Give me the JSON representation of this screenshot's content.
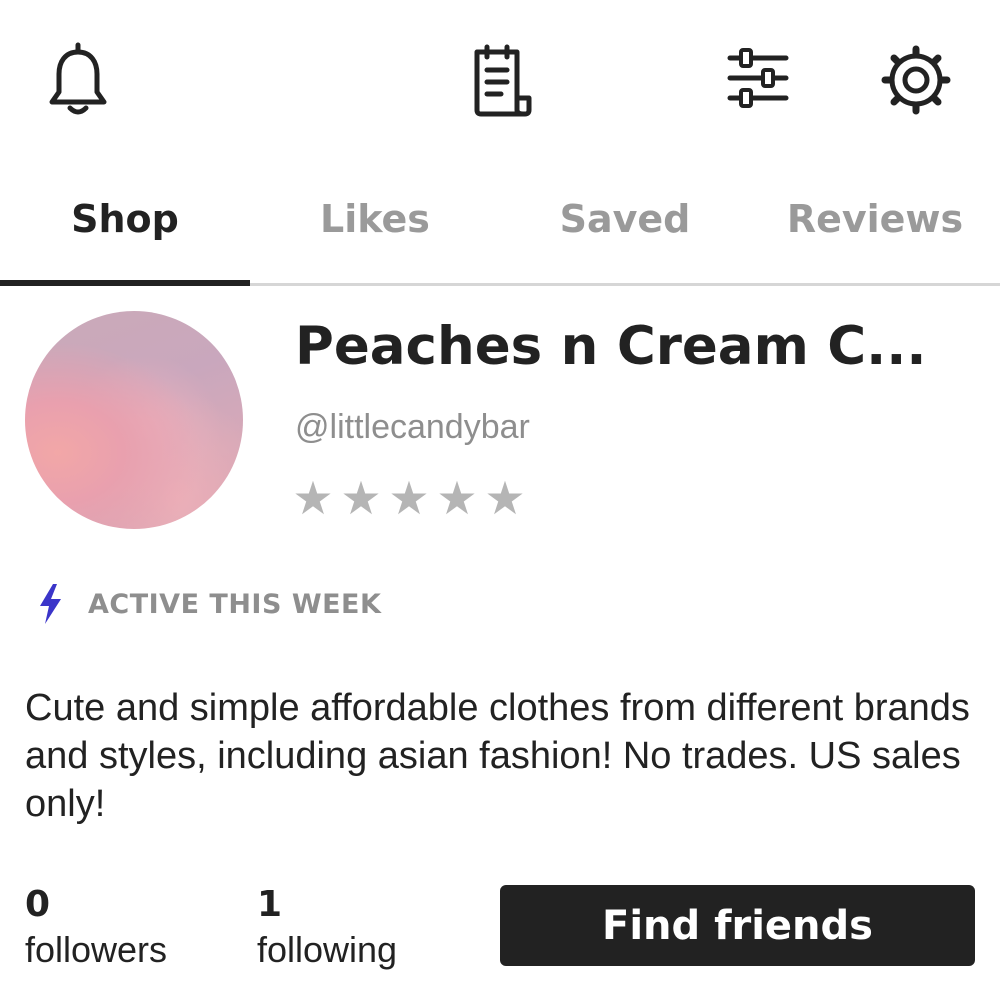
{
  "header": {
    "icons": [
      "bell-icon",
      "clipboard-icon",
      "sliders-icon",
      "gear-icon"
    ]
  },
  "tabs": [
    {
      "label": "Shop",
      "active": true
    },
    {
      "label": "Likes",
      "active": false
    },
    {
      "label": "Saved",
      "active": false
    },
    {
      "label": "Reviews",
      "active": false
    }
  ],
  "profile": {
    "shop_name": "Peaches n Cream C...",
    "handle": "@littlecandybar",
    "rating": 0,
    "rating_max": 5,
    "star_glyph": "★",
    "activity": "ACTIVE THIS WEEK",
    "bio": "Cute and simple affordable clothes from different brands and styles, including asian fashion! No trades. US sales only!"
  },
  "stats": {
    "followers": {
      "count": "0",
      "label": "followers"
    },
    "following": {
      "count": "1",
      "label": "following"
    }
  },
  "actions": {
    "find_friends_label": "Find friends"
  },
  "colors": {
    "text_primary": "#222222",
    "text_muted": "#9a9a9a",
    "accent_bolt": "#3b35c9",
    "button_bg": "#222222",
    "star_empty": "#b5b5b5"
  }
}
